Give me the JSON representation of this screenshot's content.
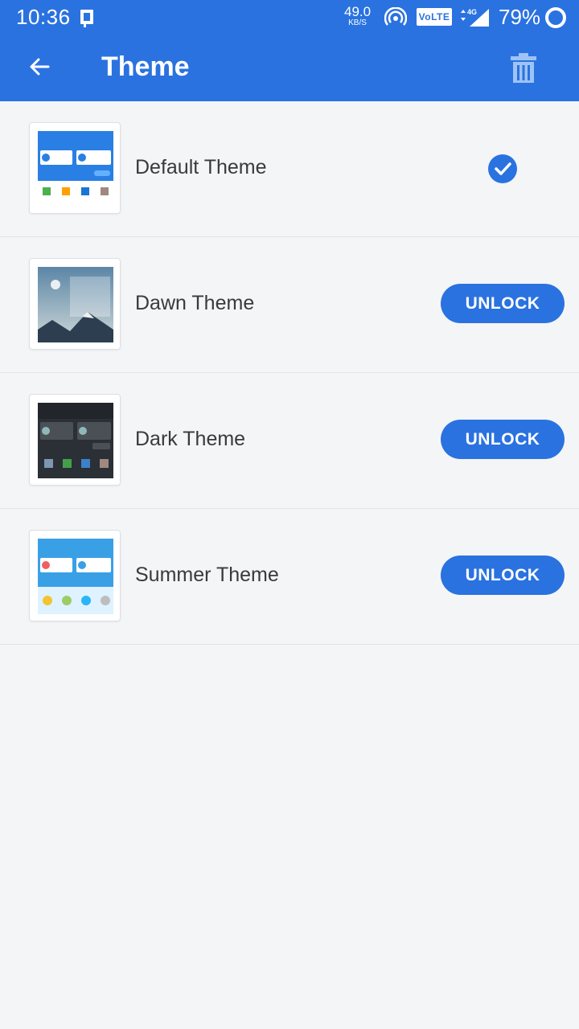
{
  "status_bar": {
    "time": "10:36",
    "net_speed": "49.0",
    "net_unit": "KB/S",
    "volte": "VoLTE",
    "network": "4G",
    "battery": "79%"
  },
  "app_bar": {
    "title": "Theme",
    "back_icon": "arrow-left-icon",
    "delete_icon": "trash-icon"
  },
  "themes": [
    {
      "name": "Default Theme",
      "state": "selected"
    },
    {
      "name": "Dawn Theme",
      "state": "locked",
      "action": "UNLOCK"
    },
    {
      "name": "Dark Theme",
      "state": "locked",
      "action": "UNLOCK"
    },
    {
      "name": "Summer Theme",
      "state": "locked",
      "action": "UNLOCK"
    }
  ],
  "colors": {
    "primary": "#2a72e0",
    "background": "#f4f5f7",
    "text": "#3a3a3a"
  }
}
